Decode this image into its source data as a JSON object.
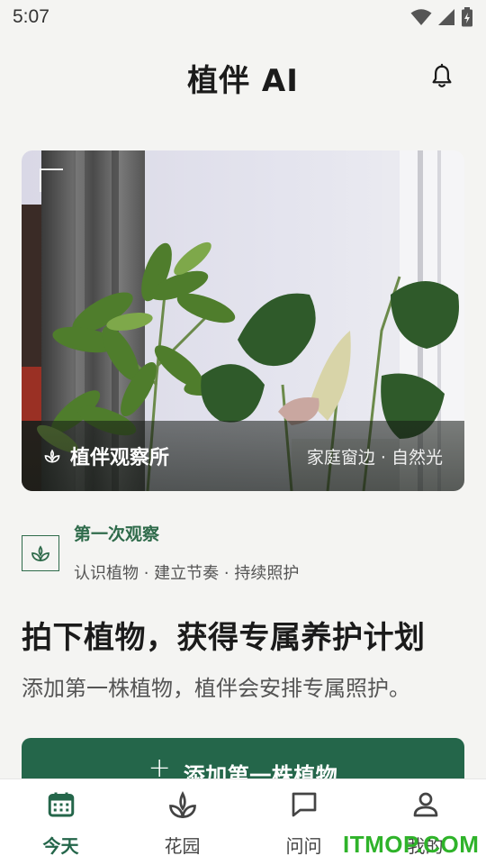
{
  "status_bar": {
    "time": "5:07"
  },
  "header": {
    "title": "植伴 AI"
  },
  "hero": {
    "name": "植伴观察所",
    "place": "家庭窗边 · 自然光"
  },
  "first_observation": {
    "title": "第一次观察",
    "subtitle": "认识植物 · 建立节奏 · 持续照护"
  },
  "main": {
    "heading": "拍下植物，获得专属养护计划",
    "description": "添加第一株植物，植伴会安排专属照护。",
    "add_button_label": "添加第一株植物",
    "add_button_icon": "+"
  },
  "bottom_nav": {
    "items": [
      {
        "label": "今天",
        "icon": "calendar-icon",
        "active": true
      },
      {
        "label": "花园",
        "icon": "sprout-icon",
        "active": false
      },
      {
        "label": "问问",
        "icon": "chat-icon",
        "active": false
      },
      {
        "label": "我的",
        "icon": "person-icon",
        "active": false
      }
    ]
  },
  "watermark": "ITMOP.COM",
  "colors": {
    "brand_green": "#24664a",
    "accent_green": "#2f6b4b",
    "background": "#f4f4f2"
  }
}
